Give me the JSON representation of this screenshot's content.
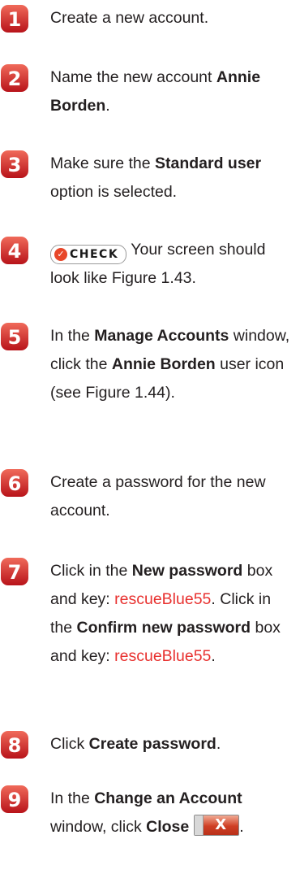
{
  "steps": [
    {
      "number": "1"
    },
    {
      "number": "2"
    },
    {
      "number": "3"
    },
    {
      "number": "4"
    },
    {
      "number": "5"
    },
    {
      "number": "6"
    },
    {
      "number": "7"
    },
    {
      "number": "8"
    },
    {
      "number": "9"
    }
  ],
  "s1": {
    "t1": "Create a new account."
  },
  "s2": {
    "t1": "Name the new account ",
    "b1": "Annie Borden",
    "t2": "."
  },
  "s3": {
    "t1": "Make sure the ",
    "b1": "Standard user",
    "t2": " option is selected."
  },
  "s4": {
    "check_label": "CHECK",
    "check_icon": "✓",
    "t1": " Your screen should look like Figure 1.43."
  },
  "s5": {
    "t1": "In the ",
    "b1": "Manage Accounts",
    "t2": " window, click the ",
    "b2": "Annie Borden",
    "t3": " user icon (see Figure 1.44)."
  },
  "s6": {
    "t1": "Create a password for the new account."
  },
  "s7": {
    "t1": "Click in the ",
    "b1": "New password",
    "t2": " box and key: ",
    "r1": "rescueBlue55",
    "t3": ".",
    "t4": " Click in the ",
    "b2": "Confirm new password",
    "t5": " box and key: ",
    "r2": "rescueBlue55",
    "t6": "."
  },
  "s8": {
    "t1": "Click ",
    "b1": "Create password",
    "t2": "."
  },
  "s9": {
    "t1": "In the ",
    "b1": "Change an Account",
    "t2": " window, click ",
    "b2": "Close",
    "close_glyph": "X",
    "t3": "."
  },
  "colors": {
    "badge": "#d8231f",
    "keyed_text": "#e8312f"
  }
}
